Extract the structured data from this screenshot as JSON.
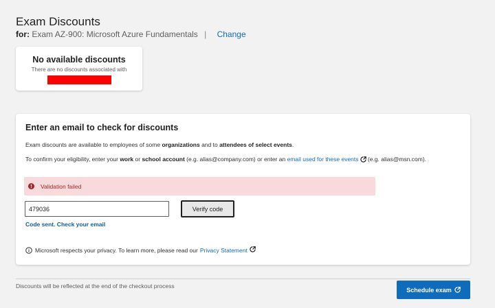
{
  "header": {
    "title": "Exam Discounts",
    "for_label": "for:",
    "exam_name": "Exam AZ-900: Microsoft Azure Fundamentals",
    "separator": "|",
    "change_link": "Change"
  },
  "no_discounts_card": {
    "title": "No available discounts",
    "subtitle": "There are no discounts associated with"
  },
  "email_check": {
    "heading": "Enter an email to check for discounts",
    "para1": {
      "prefix": "Exam discounts are available to employees of some ",
      "organizations": "organizations",
      "middle": " and to ",
      "attendees": "attendees of select events",
      "suffix": "."
    },
    "para2": {
      "prefix": "To confirm your eligibility, enter your ",
      "work": "work",
      "or1": " or ",
      "school_account": "school account",
      "middle": " (e.g. alias@company.com) or enter an ",
      "events_link": "email used for these events",
      "suffix": " (e.g. alias@msn.com)."
    },
    "alert_message": "Validation failed",
    "code_value": "479036",
    "verify_button": "Verify code",
    "code_sent": "Code sent. Check your email",
    "privacy_text": "Microsoft respects your privacy. To learn more, please read our",
    "privacy_link": "Privacy Statement"
  },
  "footer": {
    "note": "Discounts will be reflected at the end of the checkout process",
    "schedule_button": "Schedule exam"
  },
  "colors": {
    "accent": "#0f6cbd",
    "error_bg": "#f8dadd",
    "error_text": "#a4262c",
    "redacted": "#ff0000"
  },
  "icons": {
    "external": "external-link-icon",
    "error": "error-circle-icon",
    "info": "info-circle-icon"
  }
}
